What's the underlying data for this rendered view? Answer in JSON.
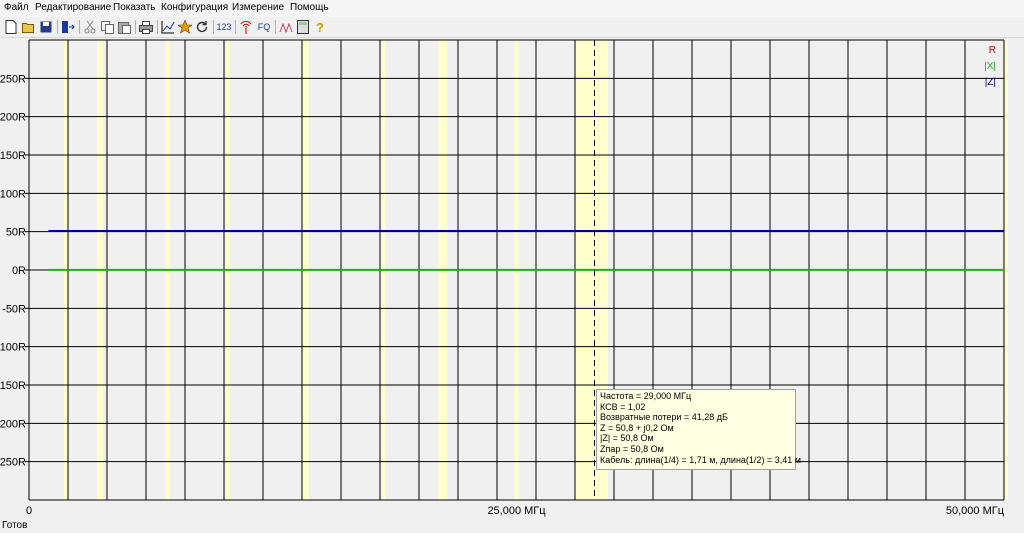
{
  "menu": [
    "Файл",
    "Редактирование",
    "Показать",
    "Конфигурация",
    "Измерение",
    "Помощь"
  ],
  "toolbar": {
    "icons": [
      "new-file-icon",
      "open-folder-icon",
      "save-icon",
      "connect-device-icon",
      "cut-icon",
      "copy-icon",
      "paste-icon",
      "print-icon",
      "graph-icon",
      "star-marker-icon",
      "refresh-icon",
      "numeric-123-icon",
      "antenna-icon",
      "frequency-fq-icon",
      "swr-curve-icon",
      "calculator-icon",
      "help-icon"
    ],
    "text_123": "123",
    "text_fq": "FQ"
  },
  "status": "Готов",
  "tooltip_lines": [
    "Частота = 29,000 МГц",
    "КСВ = 1,02",
    "Возвратные потери = 41,28 дБ",
    "Z = 50,8 + j0,2 Ом",
    "|Z| = 50,8 Ом",
    "Zпар = 50,8 Ом",
    "Кабель: длина(1/4) = 1,71 м, длина(1/2) = 3,41 м"
  ],
  "colors": {
    "R": "#cc0000",
    "X": "#22aa22",
    "Z": "#00007a",
    "plot_bg": "#f0f0f0",
    "band": "#ffffcc"
  },
  "chart_data": {
    "type": "line",
    "xlim": [
      0,
      50
    ],
    "ylim": [
      -300,
      300
    ],
    "x_tick_labels": [
      {
        "x": 0,
        "label": "0"
      },
      {
        "x": 25,
        "label": "25,000 МГц"
      },
      {
        "x": 50,
        "label": "50,000 МГц"
      }
    ],
    "y_ticks": [
      250,
      200,
      150,
      100,
      50,
      0,
      -50,
      -100,
      -150,
      -200,
      -250
    ],
    "y_tick_labels": [
      "250R",
      "200R",
      "150R",
      "100R",
      "50R",
      "0R",
      "-50R",
      "-100R",
      "-150R",
      "-200R",
      "-250R"
    ],
    "x_grid_count": 25,
    "bands": [
      [
        1.8,
        2.0
      ],
      [
        3.5,
        3.8
      ],
      [
        7.0,
        7.2
      ],
      [
        10.1,
        10.15
      ],
      [
        14.0,
        14.35
      ],
      [
        18.068,
        18.168
      ],
      [
        21.0,
        21.45
      ],
      [
        24.89,
        24.99
      ],
      [
        28.0,
        29.7
      ],
      [
        50.0,
        50.1
      ]
    ],
    "marker_x": 29.0,
    "series": [
      {
        "name": "R",
        "x": [
          1,
          50
        ],
        "values": [
          50.8,
          50.8
        ]
      },
      {
        "name": "|X|",
        "x": [
          1,
          50
        ],
        "values": [
          0.2,
          0.2
        ]
      },
      {
        "name": "|Z|",
        "x": [
          1,
          50
        ],
        "values": [
          50.8,
          50.8
        ]
      }
    ]
  }
}
